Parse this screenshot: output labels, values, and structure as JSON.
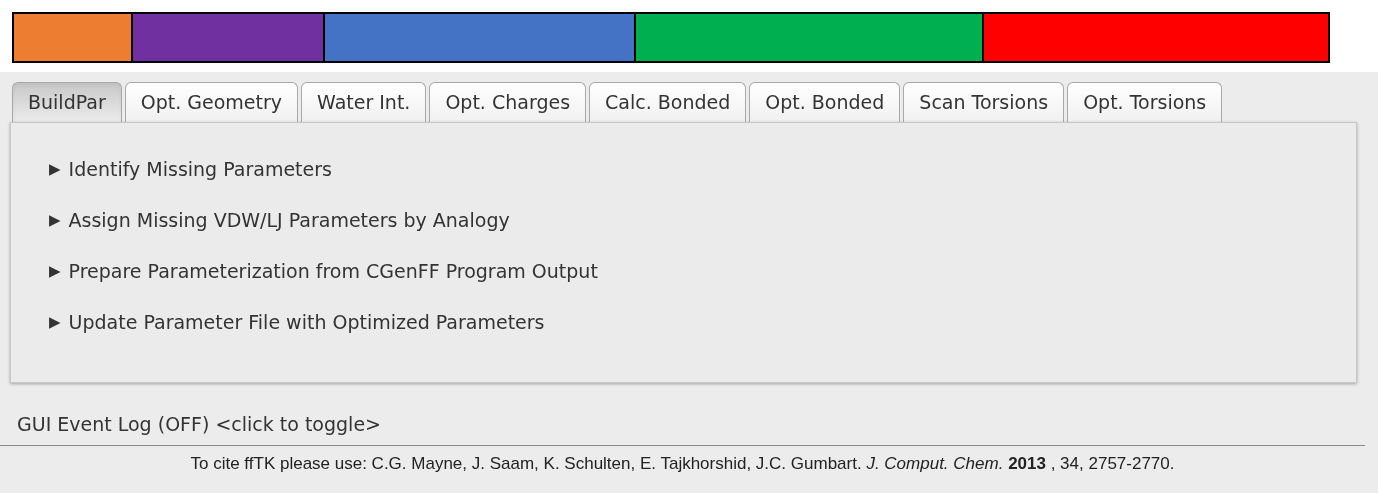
{
  "color_bars": [
    {
      "color": "#ed7d31"
    },
    {
      "color": "#7030a0"
    },
    {
      "color": "#4472c4"
    },
    {
      "color": "#00b050"
    },
    {
      "color": "#ff0000"
    }
  ],
  "tabs": [
    {
      "label": "BuildPar",
      "selected": true
    },
    {
      "label": "Opt. Geometry",
      "selected": false
    },
    {
      "label": "Water Int.",
      "selected": false
    },
    {
      "label": "Opt. Charges",
      "selected": false
    },
    {
      "label": "Calc. Bonded",
      "selected": false
    },
    {
      "label": "Opt. Bonded",
      "selected": false
    },
    {
      "label": "Scan Torsions",
      "selected": false
    },
    {
      "label": "Opt. Torsions",
      "selected": false
    }
  ],
  "sections": [
    {
      "arrow": "▶",
      "label": "Identify Missing Parameters",
      "expanded": false
    },
    {
      "arrow": "▶",
      "label": "Assign Missing VDW/LJ Parameters by Analogy",
      "expanded": false
    },
    {
      "arrow": "▶",
      "label": "Prepare Parameterization from CGenFF Program Output",
      "expanded": false
    },
    {
      "arrow": "▶",
      "label": "Update Parameter File with Optimized Parameters",
      "expanded": false
    }
  ],
  "event_log": {
    "label": "GUI Event Log (OFF) <click to toggle>"
  },
  "citation": "To cite ffTK please use:  C.G. Mayne, J. Saam, K. Schulten, E. Tajkhorshid, J.C. Gumbart.  *J. Comput. Chem.*  **2013** , 34, 2757-2770."
}
